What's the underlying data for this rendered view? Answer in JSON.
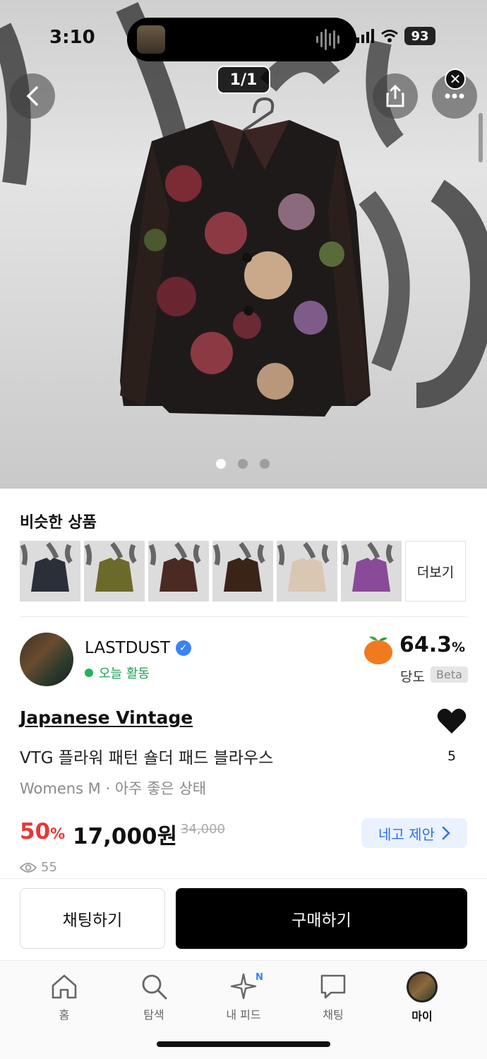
{
  "status_bar": {
    "time": "3:10",
    "battery": "93"
  },
  "hero": {
    "image_counter": "1/1",
    "page_dots": 3,
    "active_dot": 0
  },
  "similar": {
    "title": "비슷한 상품",
    "more_label": "더보기",
    "items": [
      {
        "tone": "#2a2f38"
      },
      {
        "tone": "#6b6a2a"
      },
      {
        "tone": "#4a2a22"
      },
      {
        "tone": "#3a2418"
      },
      {
        "tone": "#d9c7b4"
      },
      {
        "tone": "#8a4a9a"
      }
    ]
  },
  "seller": {
    "name": "LASTDUST",
    "activity": "오늘 활동",
    "sweetness_value": "64.3",
    "sweetness_unit": "%",
    "sweetness_label": "당도",
    "beta": "Beta"
  },
  "product": {
    "brand": "Japanese Vintage",
    "name": "VTG 플라워 패턴  숄더 패드 블라우스",
    "meta": "Womens M · 아주 좋은 상태",
    "likes": "5",
    "discount_value": "50",
    "discount_unit": "%",
    "price": "17,000원",
    "original_price": "34,000",
    "offer_label": "네고 제안",
    "views": "55"
  },
  "actions": {
    "chat_label": "채팅하기",
    "buy_label": "구매하기"
  },
  "tabs": [
    {
      "label": "홈",
      "icon": "home-icon"
    },
    {
      "label": "탐색",
      "icon": "search-icon"
    },
    {
      "label": "내 피드",
      "icon": "sparkle-icon"
    },
    {
      "label": "채팅",
      "icon": "chat-bubble-icon"
    },
    {
      "label": "마이",
      "icon": "profile-avatar"
    }
  ],
  "feed_badge": "N",
  "colors": {
    "discount": "#e53935",
    "offer": "#2f6fe4",
    "online": "#22b35a",
    "verified": "#3b82f6"
  }
}
